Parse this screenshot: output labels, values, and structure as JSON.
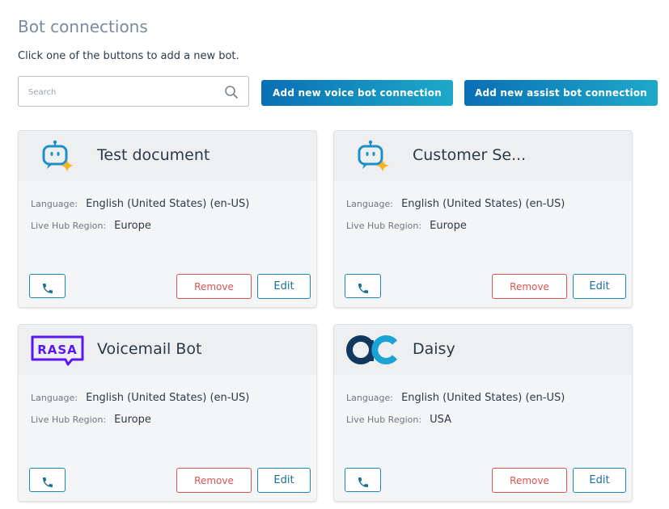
{
  "page": {
    "title": "Bot connections",
    "subtitle": "Click one of the buttons to add a new bot."
  },
  "search": {
    "placeholder": "Search",
    "value": "",
    "icon": "search-icon"
  },
  "actions": {
    "add_voice_label": "Add new voice bot connection",
    "add_assist_label": "Add new assist bot connection"
  },
  "colors": {
    "primary_gradient_start": "#0a6fb5",
    "primary_gradient_end": "#1da9c9",
    "remove": "#d9534f",
    "edit_border": "#1a8ab5"
  },
  "cards": [
    {
      "title": "Test document",
      "logo": "robot-sparkle-icon",
      "language_label": "Language:",
      "language": "English (United States) (en-US)",
      "region_label": "Live Hub Region:",
      "region": "Europe",
      "phone_icon": "phone-icon",
      "remove_label": "Remove",
      "edit_label": "Edit"
    },
    {
      "title": "Customer Se...",
      "logo": "robot-sparkle-icon",
      "language_label": "Language:",
      "language": "English (United States) (en-US)",
      "region_label": "Live Hub Region:",
      "region": "Europe",
      "phone_icon": "phone-icon",
      "remove_label": "Remove",
      "edit_label": "Edit"
    },
    {
      "title": "Voicemail Bot",
      "logo": "rasa-logo",
      "logo_text": "RASA",
      "language_label": "Language:",
      "language": "English (United States) (en-US)",
      "region_label": "Live Hub Region:",
      "region": "Europe",
      "phone_icon": "phone-icon",
      "remove_label": "Remove",
      "edit_label": "Edit"
    },
    {
      "title": "Daisy",
      "logo": "ac-logo",
      "language_label": "Language:",
      "language": "English (United States) (en-US)",
      "region_label": "Live Hub Region:",
      "region": "USA",
      "phone_icon": "phone-icon",
      "remove_label": "Remove",
      "edit_label": "Edit"
    }
  ]
}
